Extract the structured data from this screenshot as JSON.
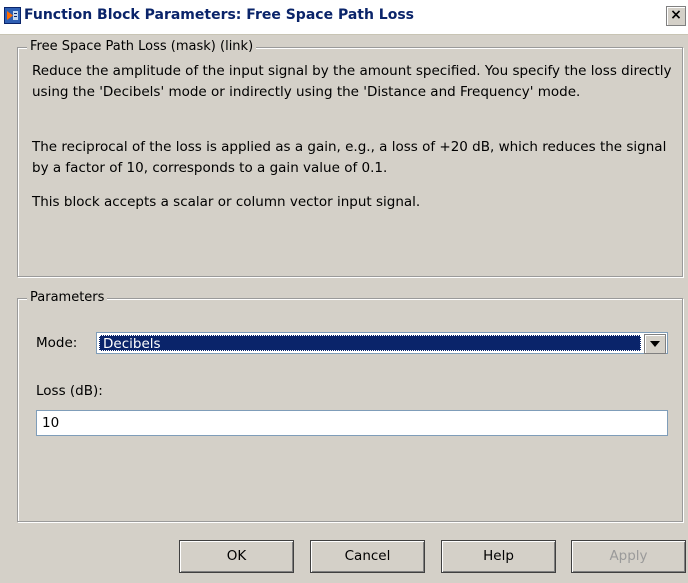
{
  "window": {
    "title": "Function Block Parameters: Free Space Path Loss",
    "close_label": "×"
  },
  "description": {
    "legend": "Free Space Path Loss (mask) (link)",
    "paragraphs": [
      "Reduce the amplitude of the input signal by the amount specified. You specify the loss directly using the 'Decibels' mode or indirectly using the 'Distance and Frequency' mode.",
      "The reciprocal of the loss is applied as a gain, e.g., a loss of +20 dB, which reduces the signal by a factor of 10, corresponds to a gain value of 0.1.",
      "This block accepts a scalar or column vector input signal."
    ]
  },
  "parameters": {
    "legend": "Parameters",
    "mode_label": "Mode:",
    "mode_value": "Decibels",
    "loss_label": "Loss (dB):",
    "loss_value": "10"
  },
  "buttons": {
    "ok": "OK",
    "cancel": "Cancel",
    "help": "Help",
    "apply": "Apply"
  },
  "colors": {
    "title_text": "#0a246a",
    "dialog_bg": "#d4d0c8",
    "selection": "#0a246a"
  },
  "icons": {
    "title_icon": "simulink-block-icon",
    "dropdown": "chevron-down-icon"
  }
}
